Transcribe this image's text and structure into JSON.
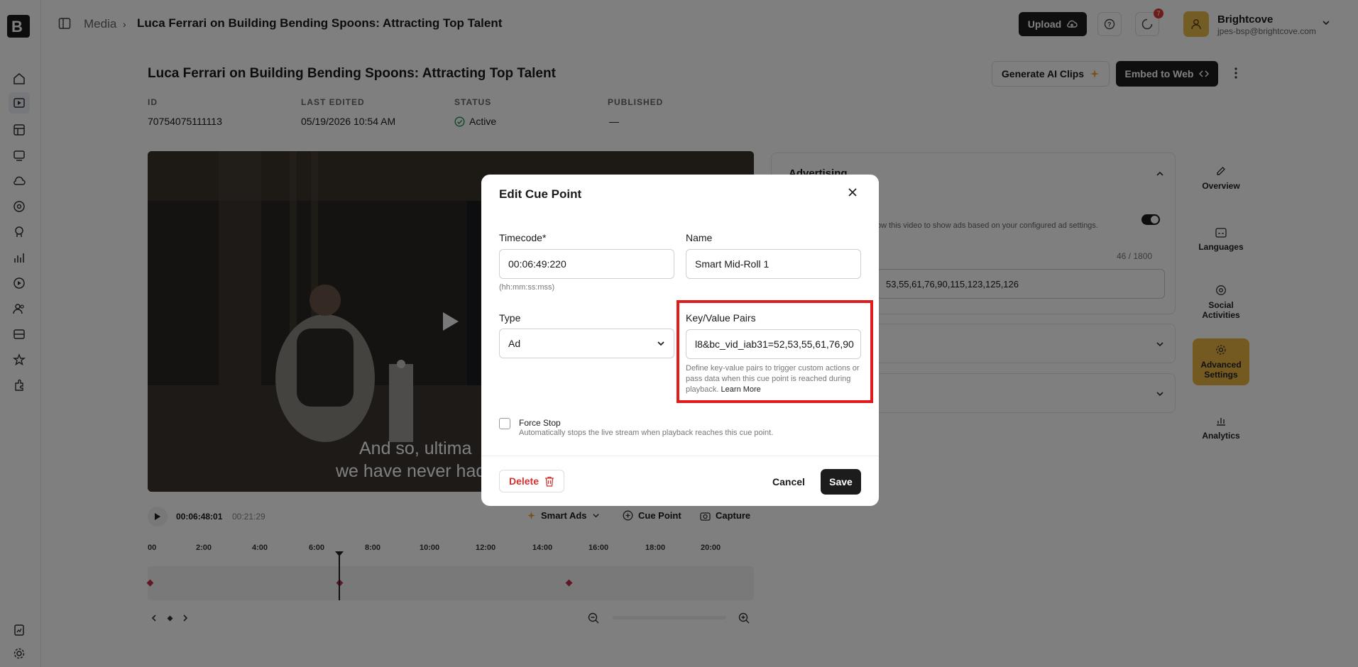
{
  "breadcrumb": {
    "root": "Media",
    "current": "Luca Ferrari on Building Bending Spoons: Attracting Top Talent"
  },
  "topbar": {
    "upload_label": "Upload",
    "notification_count": "7",
    "account_name": "Brightcove",
    "account_email": "jpes-bsp@brightcove.com"
  },
  "page": {
    "title": "Luca Ferrari on Building Bending Spoons: Attracting Top Talent",
    "generate_ai_clips": "Generate AI Clips",
    "embed_to_web": "Embed to Web",
    "meta": [
      {
        "label": "ID",
        "value": "70754075111113"
      },
      {
        "label": "LAST EDITED",
        "value": "05/19/2026 10:54 AM"
      },
      {
        "label": "STATUS",
        "value": "Active"
      },
      {
        "label": "PUBLISHED",
        "value": "—"
      }
    ]
  },
  "video": {
    "caption_line1": "And so, ultima",
    "caption_line2": "we have never had"
  },
  "player": {
    "current_time": "00:06:48:01",
    "duration": "00:21:29",
    "smart_ads": "Smart Ads",
    "cue_point": "Cue Point",
    "capture": "Capture",
    "ticks": [
      "00",
      "2:00",
      "4:00",
      "6:00",
      "8:00",
      "10:00",
      "12:00",
      "14:00",
      "16:00",
      "18:00",
      "20:00"
    ]
  },
  "right_panel": {
    "advertising_title": "Advertising",
    "ad_description": "ow this video to show ads based on your configured ad settings.",
    "char_count": "46 / 1800",
    "keyvalue_preview": "53,55,61,76,90,115,123,125,126",
    "tabs": [
      {
        "label": "Overview",
        "icon": "pencil-icon"
      },
      {
        "label": "Languages",
        "icon": "subtitles-icon"
      },
      {
        "label": "Social Activities",
        "icon": "social-icon"
      },
      {
        "label": "Advanced Settings",
        "icon": "gear-icon"
      },
      {
        "label": "Analytics",
        "icon": "bar-chart-icon"
      }
    ]
  },
  "modal": {
    "title": "Edit Cue Point",
    "timecode_label": "Timecode*",
    "timecode_value": "00:06:49:220",
    "timecode_hint": "(hh:mm:ss:mss)",
    "name_label": "Name",
    "name_value": "Smart Mid-Roll 1",
    "type_label": "Type",
    "type_value": "Ad",
    "kv_label": "Key/Value Pairs",
    "kv_value": "l8&bc_vid_iab31=52,53,55,61,76,90",
    "kv_hint": "Define key-value pairs to trigger custom actions or pass data when this cue point is reached during playback.",
    "kv_learn_more": "Learn More",
    "force_stop_label": "Force Stop",
    "force_stop_hint": "Automatically stops the live stream when playback reaches this cue point.",
    "delete_label": "Delete",
    "cancel_label": "Cancel",
    "save_label": "Save"
  }
}
